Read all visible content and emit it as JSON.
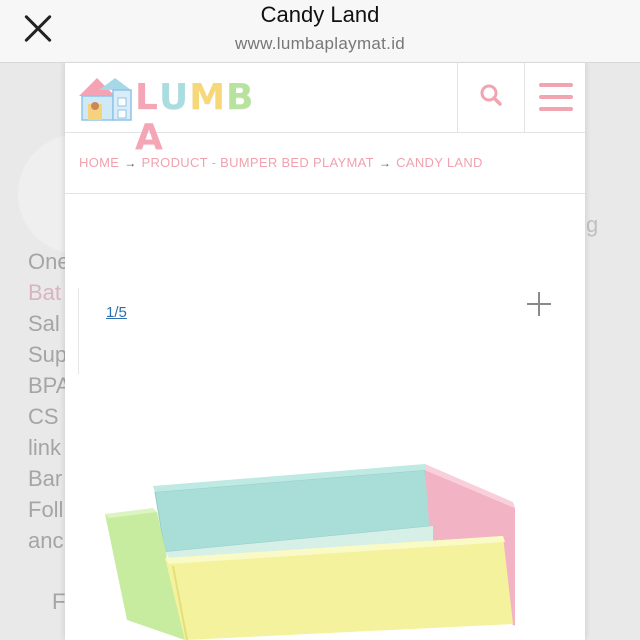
{
  "browser": {
    "title": "Candy Land",
    "url": "www.lumbaplaymat.id",
    "close_icon": "close-icon"
  },
  "background": {
    "lines": [
      "One",
      "Bat",
      "Sal",
      "Sup",
      "BPA",
      "CS",
      "link",
      "Bar",
      "Foll",
      "anc",
      "F"
    ],
    "right_letter": "g"
  },
  "header": {
    "logo_text": "LUMBA",
    "logo_colors": [
      "#f4a6b6",
      "#a9dde0",
      "#f6d878",
      "#b8e39e",
      "#f4a6b6"
    ],
    "search_icon": "search-icon",
    "menu_icon": "hamburger-menu-icon",
    "accent": "#f1a5b0"
  },
  "breadcrumb": {
    "items": [
      "HOME",
      "PRODUCT - BUMPER BED PLAYMAT",
      "CANDY LAND"
    ],
    "separator": "→"
  },
  "gallery": {
    "counter": "1/5",
    "expand_icon": "plus-icon",
    "image_colors": {
      "front": "#f4f29d",
      "back": "#a8ded7",
      "left": "#c7eca0",
      "right": "#f2b3c4"
    }
  }
}
